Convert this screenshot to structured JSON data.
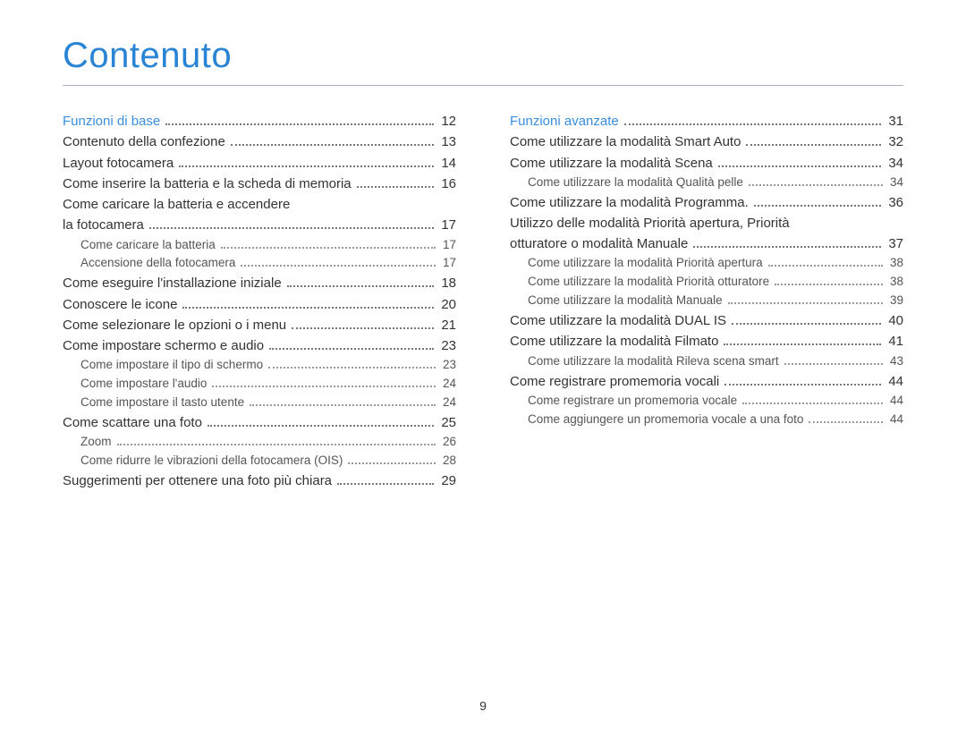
{
  "title": "Contenuto",
  "page_number": "9",
  "left_section": {
    "heading": {
      "label": "Funzioni di base",
      "page": "12"
    },
    "items": [
      {
        "label": "Contenuto della confezione",
        "page": "13",
        "level": 1
      },
      {
        "label": "Layout fotocamera",
        "page": "14",
        "level": 1
      },
      {
        "label": "Come inserire la batteria e la scheda di memoria",
        "page": "16",
        "level": 1
      },
      {
        "label_pre": "Come caricare la batteria e accendere",
        "label": "la fotocamera",
        "page": "17",
        "level": 1
      },
      {
        "label": "Come caricare la batteria",
        "page": "17",
        "level": 2
      },
      {
        "label": "Accensione della fotocamera",
        "page": "17",
        "level": 2
      },
      {
        "label": "Come eseguire l'installazione iniziale",
        "page": "18",
        "level": 1
      },
      {
        "label": "Conoscere le icone",
        "page": "20",
        "level": 1
      },
      {
        "label": "Come selezionare le opzioni o i menu",
        "page": "21",
        "level": 1
      },
      {
        "label": "Come impostare schermo e audio",
        "page": "23",
        "level": 1
      },
      {
        "label": "Come impostare il tipo di schermo",
        "page": "23",
        "level": 2
      },
      {
        "label": "Come impostare l'audio",
        "page": "24",
        "level": 2
      },
      {
        "label": "Come impostare il tasto utente",
        "page": "24",
        "level": 2
      },
      {
        "label": "Come scattare una foto",
        "page": "25",
        "level": 1
      },
      {
        "label": "Zoom",
        "page": "26",
        "level": 2
      },
      {
        "label": "Come ridurre le vibrazioni della fotocamera (OIS)",
        "page": "28",
        "level": 2
      },
      {
        "label": "Suggerimenti per ottenere una foto più chiara",
        "page": "29",
        "level": 1
      }
    ]
  },
  "right_section": {
    "heading": {
      "label": "Funzioni avanzate",
      "page": "31"
    },
    "items": [
      {
        "label": "Come utilizzare la modalità Smart Auto",
        "page": "32",
        "level": 1
      },
      {
        "label": "Come utilizzare la modalità Scena",
        "page": "34",
        "level": 1
      },
      {
        "label": "Come utilizzare la modalità Qualità pelle",
        "page": "34",
        "level": 2
      },
      {
        "label": "Come utilizzare la modalità Programma.",
        "page": "36",
        "level": 1
      },
      {
        "label_pre": "Utilizzo delle modalità Priorità apertura, Priorità",
        "label": "otturatore o modalità Manuale",
        "page": "37",
        "level": 1
      },
      {
        "label": "Come utilizzare la modalità Priorità apertura",
        "page": "38",
        "level": 2
      },
      {
        "label": "Come utilizzare la modalità Priorità otturatore",
        "page": "38",
        "level": 2
      },
      {
        "label": "Come utilizzare la modalità Manuale",
        "page": "39",
        "level": 2
      },
      {
        "label": "Come utilizzare la modalità DUAL IS",
        "page": "40",
        "level": 1
      },
      {
        "label": "Come utilizzare la modalità Filmato",
        "page": "41",
        "level": 1
      },
      {
        "label": "Come utilizzare la modalità Rileva scena smart",
        "page": "43",
        "level": 2
      },
      {
        "label": "Come registrare promemoria vocali",
        "page": "44",
        "level": 1
      },
      {
        "label": "Come registrare un promemoria vocale",
        "page": "44",
        "level": 2
      },
      {
        "label": "Come aggiungere un promemoria vocale a una foto",
        "page": "44",
        "level": 2
      }
    ]
  }
}
